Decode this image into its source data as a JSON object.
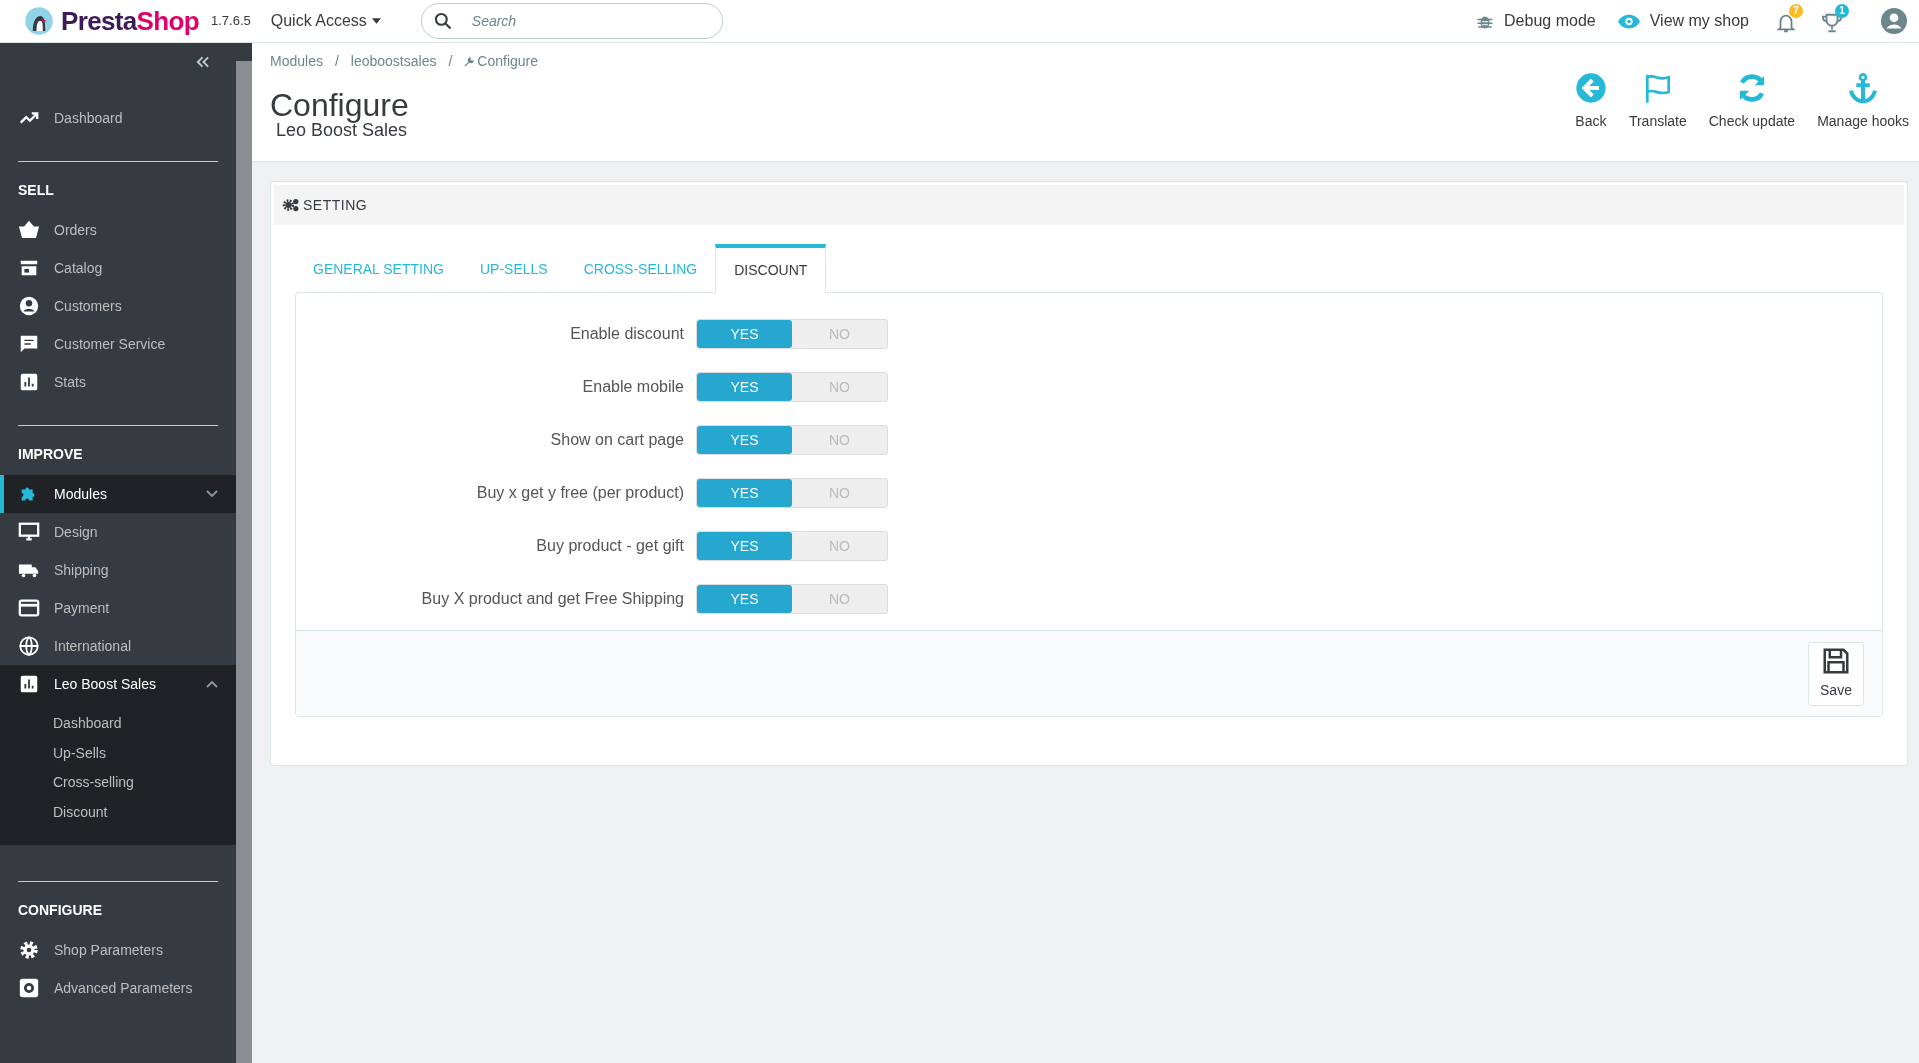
{
  "topbar": {
    "logo": "PrestaShop",
    "version": "1.7.6.5",
    "quick_access": "Quick Access",
    "search": {
      "placeholder": "Search"
    },
    "debug": "Debug mode",
    "view_shop": "View my shop",
    "notifications": "7",
    "trophies": "1"
  },
  "sidebar": {
    "sections": [
      {
        "items": [
          {
            "label": "Dashboard",
            "selected": false
          }
        ]
      },
      {
        "title": "SELL",
        "items": [
          {
            "label": "Orders",
            "selected": false
          },
          {
            "label": "Catalog",
            "selected": false
          },
          {
            "label": "Customers",
            "selected": false
          },
          {
            "label": "Customer Service",
            "selected": false
          },
          {
            "label": "Stats",
            "selected": false
          }
        ]
      },
      {
        "title": "IMPROVE",
        "items": [
          {
            "label": "Modules",
            "selected": true,
            "expanded": false
          },
          {
            "label": "Design",
            "selected": false
          },
          {
            "label": "Shipping",
            "selected": false
          },
          {
            "label": "Payment",
            "selected": false
          },
          {
            "label": "International",
            "selected": false
          },
          {
            "label": "Leo Boost Sales",
            "selected": false,
            "expanded": true,
            "children": [
              "Dashboard",
              "Up-Sells",
              "Cross-selling",
              "Discount"
            ]
          }
        ]
      },
      {
        "title": "CONFIGURE",
        "items": [
          {
            "label": "Shop Parameters",
            "selected": false
          },
          {
            "label": "Advanced Parameters",
            "selected": false
          }
        ]
      }
    ]
  },
  "breadcrumb": [
    {
      "kind": "link",
      "text": "Modules"
    },
    {
      "kind": "separator",
      "text": "/"
    },
    {
      "kind": "link",
      "text": "leoboostsales"
    },
    {
      "kind": "separator",
      "text": "/"
    },
    {
      "kind": "current",
      "text": "Configure"
    }
  ],
  "page_title": "Configure",
  "page_subtitle": "Leo Boost Sales",
  "toolbar": [
    {
      "label": "Back"
    },
    {
      "label": "Translate"
    },
    {
      "label": "Check update"
    },
    {
      "label": "Manage hooks"
    }
  ],
  "panel": {
    "title": "SETTING",
    "tabs": [
      {
        "label": "GENERAL SETTING",
        "selected": false
      },
      {
        "label": "UP-SELLS",
        "selected": false
      },
      {
        "label": "CROSS-SELLING",
        "selected": false
      },
      {
        "label": "DISCOUNT",
        "selected": true
      }
    ],
    "options": [
      {
        "label": "Enable discount",
        "on": true,
        "yes": "YES",
        "no": "NO"
      },
      {
        "label": "Enable mobile",
        "on": true,
        "yes": "YES",
        "no": "NO"
      },
      {
        "label": "Show on cart page",
        "on": true,
        "yes": "YES",
        "no": "NO"
      },
      {
        "label": "Buy x get y free (per product)",
        "on": true,
        "yes": "YES",
        "no": "NO"
      },
      {
        "label": "Buy product - get gift",
        "on": true,
        "yes": "YES",
        "no": "NO"
      },
      {
        "label": "Buy X product and get Free Shipping",
        "on": true,
        "yes": "YES",
        "no": "NO"
      }
    ],
    "save": "Save"
  }
}
